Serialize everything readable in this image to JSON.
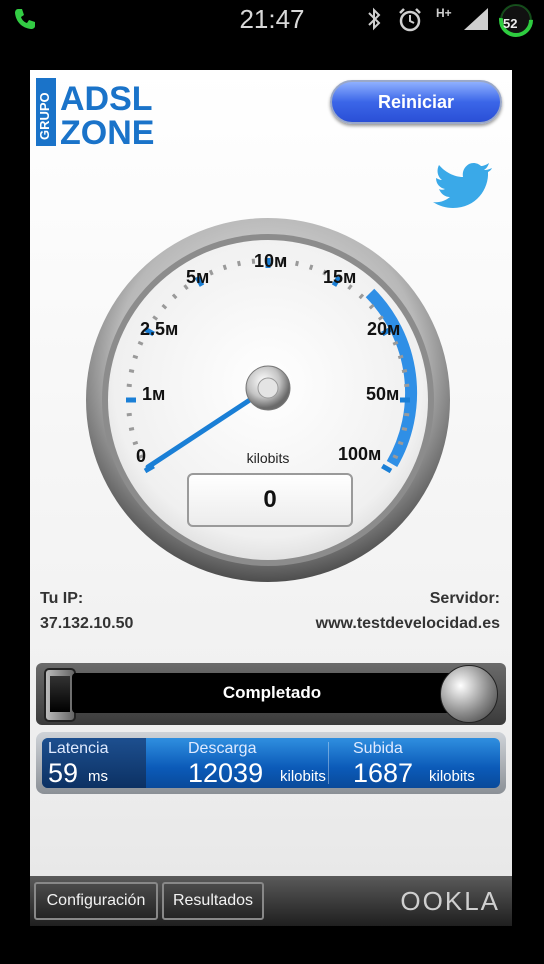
{
  "status_bar": {
    "time": "21:47",
    "network": "H+",
    "battery": "52",
    "icons": [
      "phone-icon",
      "bluetooth-icon",
      "alarm-icon",
      "network-type-icon",
      "signal-icon",
      "battery-icon"
    ]
  },
  "header": {
    "logo": {
      "line1": "ADSL",
      "line2": "ZONE",
      "vertical": "GRUPO"
    },
    "restart_label": "Reiniciar",
    "twitter_icon": "twitter-bird-icon"
  },
  "gauge": {
    "ticks": [
      "0",
      "1м",
      "2.5м",
      "5м",
      "10м",
      "15м",
      "20м",
      "50м",
      "100м"
    ],
    "unit": "kilobits",
    "value": "0",
    "needle_value": 0
  },
  "connection": {
    "ip_label": "Tu IP:",
    "ip_value": "37.132.10.50",
    "server_label": "Servidor:",
    "server_value": "www.testdevelocidad.es"
  },
  "status": {
    "text": "Completado"
  },
  "results": {
    "latency": {
      "label": "Latencia",
      "value": "59",
      "unit": "ms"
    },
    "download": {
      "label": "Descarga",
      "value": "12039",
      "unit": "kilobits"
    },
    "upload": {
      "label": "Subida",
      "value": "1687",
      "unit": "kilobits"
    }
  },
  "bottom": {
    "config_label": "Configuración",
    "results_label": "Resultados",
    "brand": "OOKLA"
  },
  "colors": {
    "accent": "#1a7fd6",
    "button": "#3b66e8",
    "panel": "#0b5ab8"
  }
}
